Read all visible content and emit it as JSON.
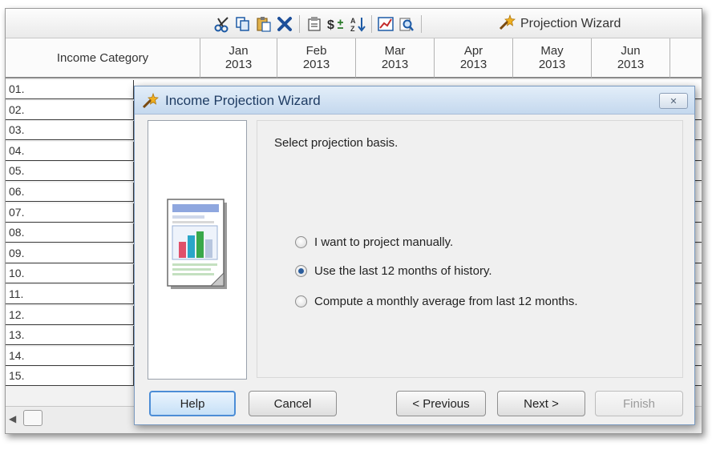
{
  "toolbar": {
    "icons": [
      "scissors-icon",
      "copy-icon",
      "paste-icon",
      "delete-icon",
      "properties-icon",
      "currency-icon",
      "sort-icon",
      "chart-icon",
      "find-icon"
    ],
    "wizard_label": "Projection Wizard"
  },
  "grid": {
    "category_header": "Income Category",
    "months": [
      {
        "month": "Jan",
        "year": "2013"
      },
      {
        "month": "Feb",
        "year": "2013"
      },
      {
        "month": "Mar",
        "year": "2013"
      },
      {
        "month": "Apr",
        "year": "2013"
      },
      {
        "month": "May",
        "year": "2013"
      },
      {
        "month": "Jun",
        "year": "2013"
      }
    ],
    "rows": [
      "01.",
      "02.",
      "03.",
      "04.",
      "05.",
      "06.",
      "07.",
      "08.",
      "09.",
      "10.",
      "11.",
      "12.",
      "13.",
      "14.",
      "15."
    ]
  },
  "dialog": {
    "title": "Income Projection Wizard",
    "close_label": "✕",
    "prompt": "Select projection basis.",
    "options": [
      {
        "label": "I want to project manually.",
        "selected": false
      },
      {
        "label": "Use the last 12 months of history.",
        "selected": true
      },
      {
        "label": "Compute a monthly average from last 12 months.",
        "selected": false
      }
    ],
    "buttons": {
      "help": "Help",
      "cancel": "Cancel",
      "previous": "< Previous",
      "next": "Next >",
      "finish": "Finish"
    }
  },
  "colors": {
    "accent": "#4c8dd6",
    "title_text": "#1f3c63"
  }
}
